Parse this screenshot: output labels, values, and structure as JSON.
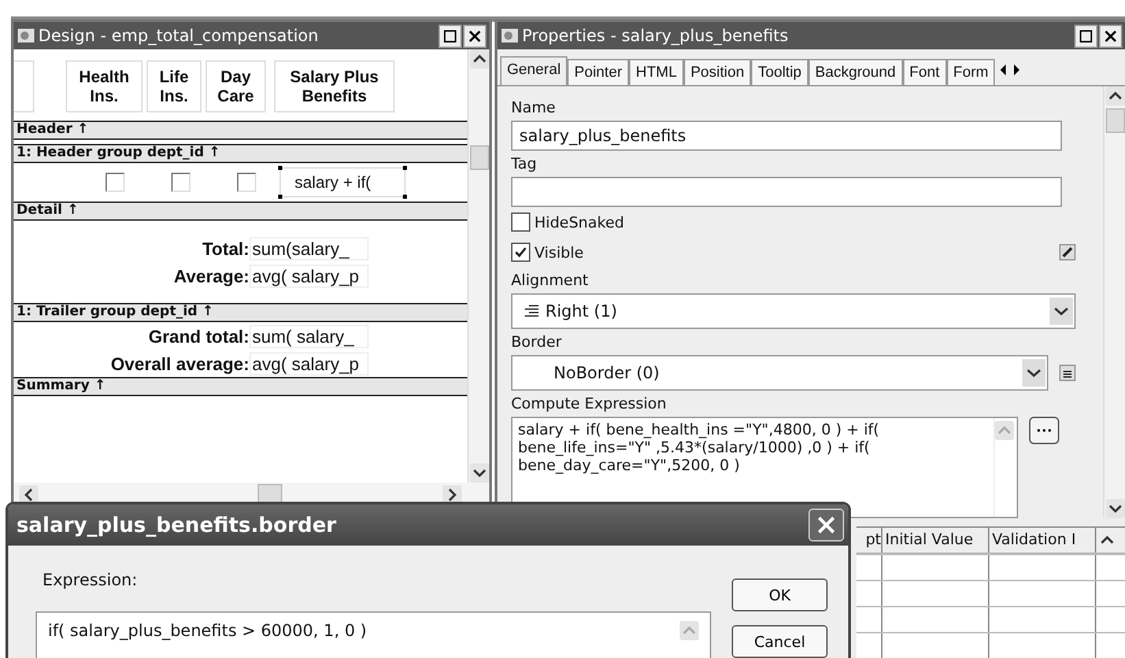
{
  "design_window": {
    "title": "Design - emp_total_compensation",
    "rows": [
      {
        "kind": "headers",
        "labels": [
          "Health Ins.",
          "Life Ins.",
          "Day Care",
          "Salary Plus Benefits"
        ]
      },
      {
        "kind": "band",
        "label": "Header ↑"
      },
      {
        "kind": "band",
        "label": "1: Header group dept_id ↑"
      },
      {
        "kind": "checkrow",
        "checks": [
          false,
          false,
          false
        ],
        "value": "salary  + if(",
        "selected": true
      },
      {
        "kind": "band",
        "label": "Detail ↑"
      },
      {
        "kind": "gap"
      },
      {
        "kind": "pair",
        "label": "Total:",
        "value": "sum(salary_"
      },
      {
        "kind": "pair",
        "label": "Average:",
        "value": "avg( salary_p"
      },
      {
        "kind": "gap"
      },
      {
        "kind": "band",
        "label": "1: Trailer group dept_id ↑"
      },
      {
        "kind": "pair",
        "label": "Grand total:",
        "value": "sum(  salary_"
      },
      {
        "kind": "pair",
        "label": "Overall average:",
        "value": "avg(  salary_p"
      },
      {
        "kind": "band",
        "label": "Summary ↑"
      }
    ]
  },
  "properties_window": {
    "title": "Properties -  salary_plus_benefits",
    "tabs": [
      {
        "label": "General",
        "selected": true
      },
      {
        "label": "Pointer",
        "selected": false
      },
      {
        "label": "HTML",
        "selected": false
      },
      {
        "label": "Position",
        "selected": false
      },
      {
        "label": "Tooltip",
        "selected": false
      },
      {
        "label": "Background",
        "selected": false
      },
      {
        "label": "Font",
        "selected": false
      },
      {
        "label": "Form",
        "selected": false
      }
    ],
    "fields": [
      {
        "kind": "text",
        "label": "Name",
        "value": "salary_plus_benefits"
      },
      {
        "kind": "text",
        "label": "Tag"
      },
      {
        "kind": "checkbox",
        "label": "HideSnaked",
        "checked": false
      },
      {
        "kind": "checkbox",
        "label": "Visible",
        "checked": true
      },
      {
        "kind": "dropdown",
        "label": "Alignment",
        "value": "Right (1)"
      },
      {
        "kind": "dropdown",
        "label": "Border",
        "value": "NoBorder (0)"
      },
      {
        "kind": "textarea",
        "label": "Compute Expression",
        "lines": [
          " salary  + if(  bene_health_ins =\"Y\",4800, 0 ) + if(",
          "bene_life_ins=\"Y\" ,5.43*(salary/1000) ,0 ) + if(",
          "bene_day_care=\"Y\",5200, 0 )"
        ]
      }
    ],
    "grid_columns": [
      "pt",
      "Initial Value",
      "Validation I"
    ]
  },
  "dialog": {
    "title": "salary_plus_benefits.border",
    "label": "Expression:",
    "expression": "if(   salary_plus_benefits > 60000, 1, 0 )",
    "buttons": [
      "OK",
      "Cancel"
    ]
  }
}
